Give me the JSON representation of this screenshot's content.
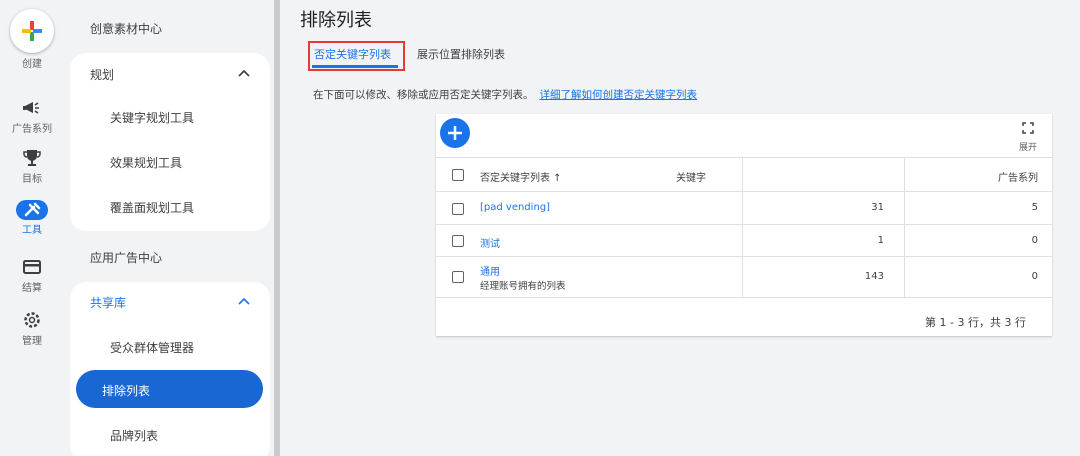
{
  "rail": {
    "create_label": "创建",
    "items": [
      {
        "label": "广告系列",
        "icon": "megaphone-icon"
      },
      {
        "label": "目标",
        "icon": "trophy-icon"
      },
      {
        "label": "工具",
        "icon": "tools-icon"
      },
      {
        "label": "结算",
        "icon": "credit-card-icon"
      },
      {
        "label": "管理",
        "icon": "gear-icon"
      }
    ]
  },
  "nav": {
    "creative_center": "创意素材中心",
    "planning": {
      "title": "规划",
      "items": [
        "关键字规划工具",
        "效果规划工具",
        "覆盖面规划工具"
      ]
    },
    "app_ads_center": "应用广告中心",
    "shared_library": {
      "title": "共享库",
      "items": [
        "受众群体管理器",
        "排除列表",
        "品牌列表"
      ]
    }
  },
  "main": {
    "page_title": "排除列表",
    "tabs": [
      "否定关键字列表",
      "展示位置排除列表"
    ],
    "description": "在下面可以修改、移除或应用否定关键字列表。",
    "learn_more": "详细了解如何创建否定关键字列表",
    "expand_label": "展开"
  },
  "table": {
    "columns": [
      "否定关键字列表 ↑",
      "关键字",
      "广告系列"
    ],
    "rows": [
      {
        "name": "[pad vending]",
        "sub": "",
        "keywords": "31",
        "campaigns": "5"
      },
      {
        "name": "测试",
        "sub": "",
        "keywords": "1",
        "campaigns": "0"
      },
      {
        "name": "通用",
        "sub": "经理账号拥有的列表",
        "keywords": "143",
        "campaigns": "0"
      }
    ],
    "pagination": "第 1 - 3 行，共 3 行"
  },
  "colors": {
    "accent": "#1a73e8",
    "highlight_box": "#e53935"
  }
}
